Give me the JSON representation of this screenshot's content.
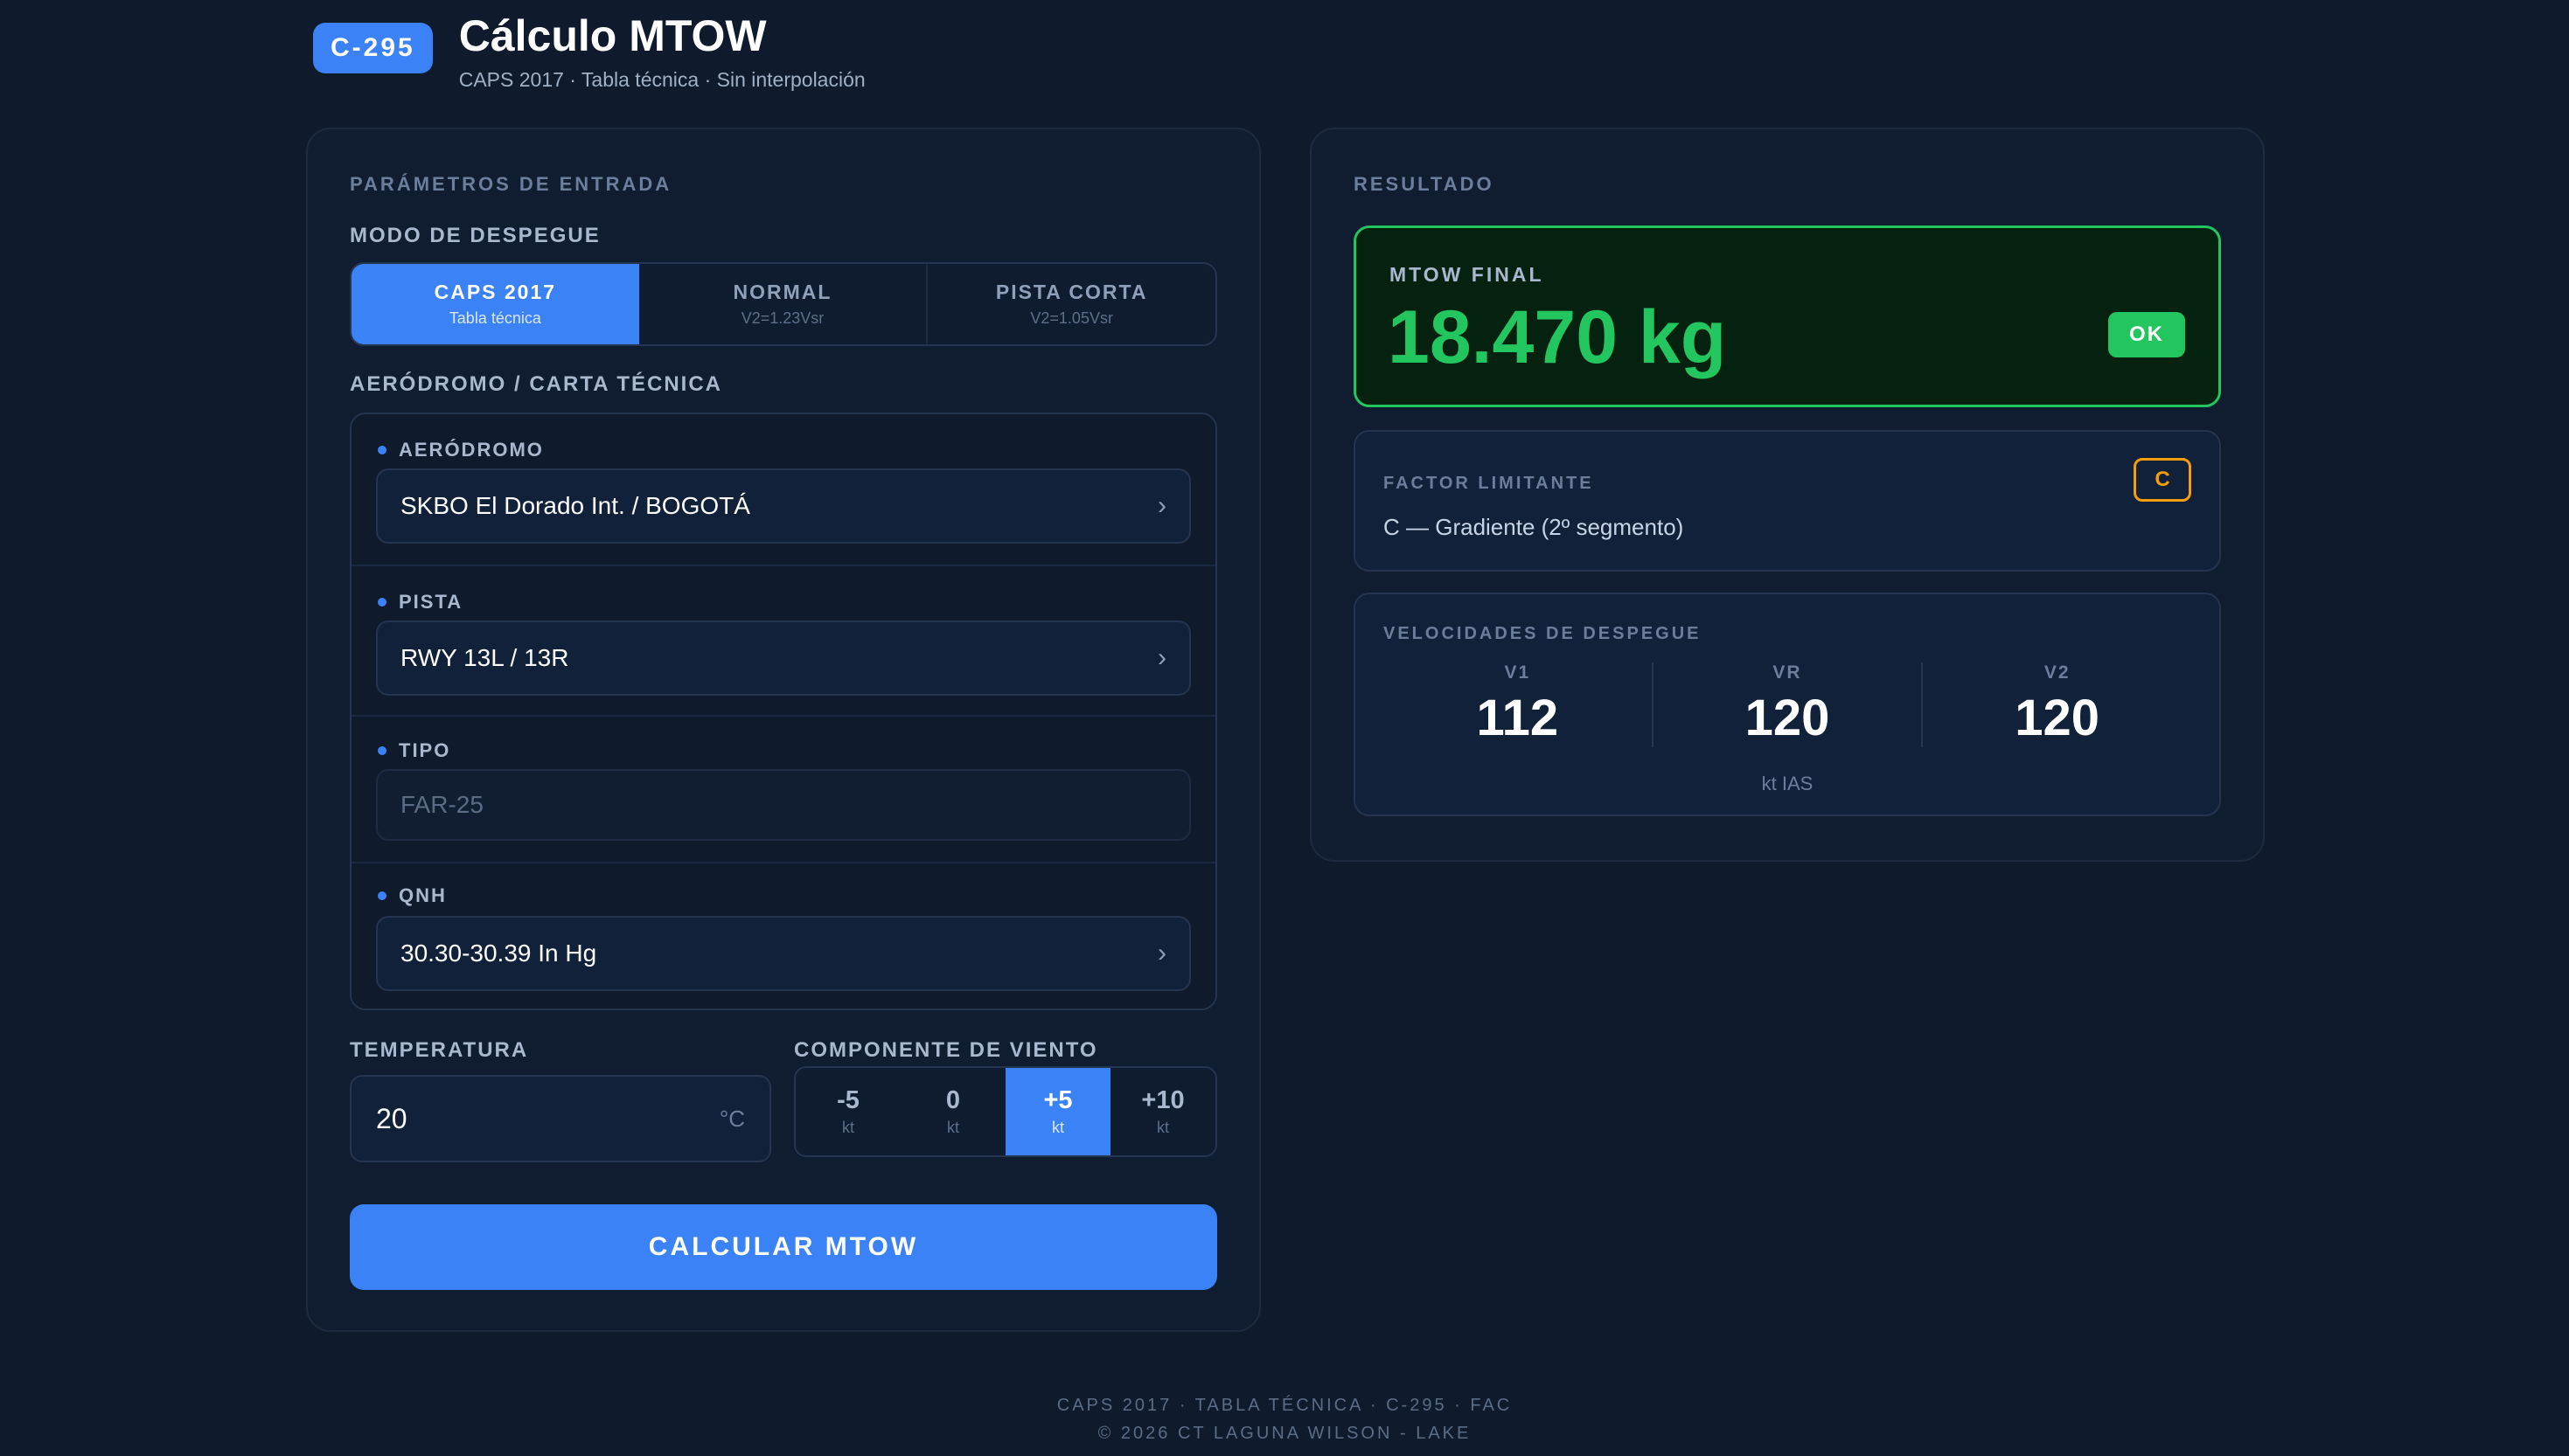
{
  "header": {
    "badge": "C-295",
    "title": "Cálculo MTOW",
    "subtitle": "CAPS 2017 · Tabla técnica · Sin interpolación"
  },
  "input": {
    "section_title": "PARÁMETROS DE ENTRADA",
    "mode_label": "MODO DE DESPEGUE",
    "modes": [
      {
        "title": "CAPS 2017",
        "sub": "Tabla técnica",
        "active": true
      },
      {
        "title": "NORMAL",
        "sub": "V2=1.23Vsr",
        "active": false
      },
      {
        "title": "PISTA CORTA",
        "sub": "V2=1.05Vsr",
        "active": false
      }
    ],
    "aero_group_label": "AERÓDROMO / CARTA TÉCNICA",
    "fields": {
      "aerodromo": {
        "label": "AERÓDROMO",
        "value": "SKBO  El Dorado Int. / BOGOTÁ"
      },
      "pista": {
        "label": "PISTA",
        "value": "RWY 13L / 13R"
      },
      "tipo": {
        "label": "TIPO",
        "value": "FAR-25"
      },
      "qnh": {
        "label": "QNH",
        "value": "30.30-30.39 In Hg"
      }
    },
    "temperature": {
      "label": "TEMPERATURA",
      "value": "20",
      "unit": "°C"
    },
    "wind": {
      "label": "COMPONENTE DE VIENTO",
      "options": [
        {
          "value": "-5",
          "unit": "kt",
          "active": false
        },
        {
          "value": "0",
          "unit": "kt",
          "active": false
        },
        {
          "value": "+5",
          "unit": "kt",
          "active": true
        },
        {
          "value": "+10",
          "unit": "kt",
          "active": false
        }
      ]
    },
    "calc_button": "CALCULAR MTOW"
  },
  "result": {
    "section_title": "RESULTADO",
    "mtow_label": "MTOW FINAL",
    "mtow_value": "18.470 kg",
    "status": "OK",
    "limit_label": "FACTOR LIMITANTE",
    "limit_value": "C — Gradiente (2º segmento)",
    "limit_code": "C",
    "speeds_title": "VELOCIDADES DE DESPEGUE",
    "speeds": [
      {
        "name": "V1",
        "value": "112"
      },
      {
        "name": "VR",
        "value": "120"
      },
      {
        "name": "V2",
        "value": "120"
      }
    ],
    "speeds_unit": "kt IAS"
  },
  "footer": {
    "line1": "CAPS 2017 · TABLA TÉCNICA · C-295 · FAC",
    "line2": "© 2026 CT LAGUNA WILSON - LAKE"
  },
  "colors": {
    "background": "#0f1a2c",
    "accent": "#3b82f6",
    "success": "#22c55e",
    "warning": "#f59e0b"
  }
}
